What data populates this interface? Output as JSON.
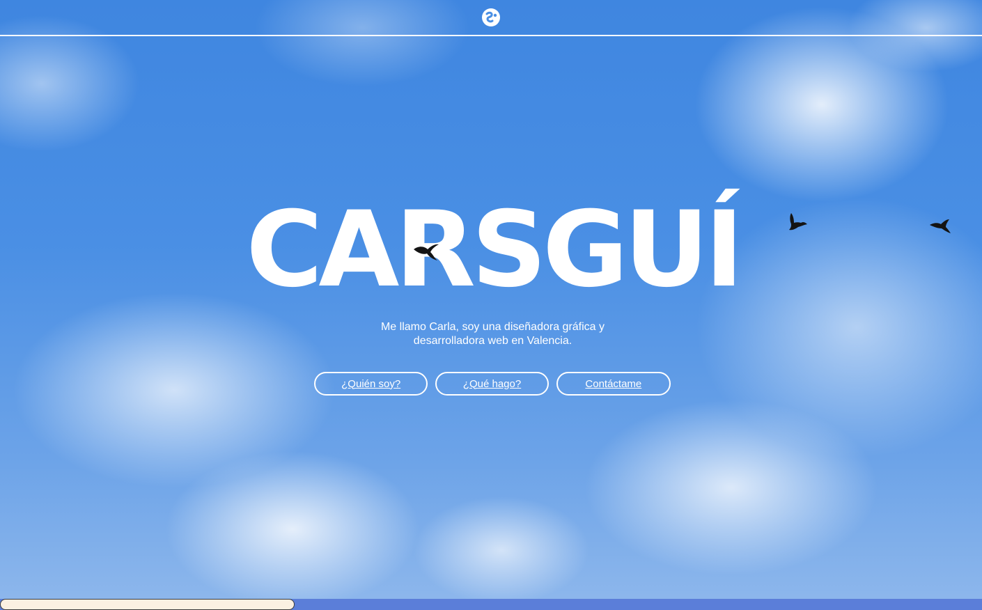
{
  "site": {
    "logo_icon": "globe-swirl-icon",
    "brand": "CARSGUÍ"
  },
  "hero": {
    "tagline_line1": "Me llamo Carla, soy una diseñadora gráfica y",
    "tagline_line2": "desarrolladora web en Valencia."
  },
  "buttons": {
    "who": "¿Quién soy?",
    "what": "¿Qué hago?",
    "contact": "Contáctame"
  },
  "decor": {
    "birds": [
      "bird-icon",
      "bird-icon",
      "bird-icon"
    ]
  },
  "scroll_progress": 0.3,
  "colors": {
    "sky": "#4a8fe4",
    "text": "#ffffff",
    "bottom_bar": "#5b7ed9",
    "progress_fill": "#fbf1e2"
  }
}
